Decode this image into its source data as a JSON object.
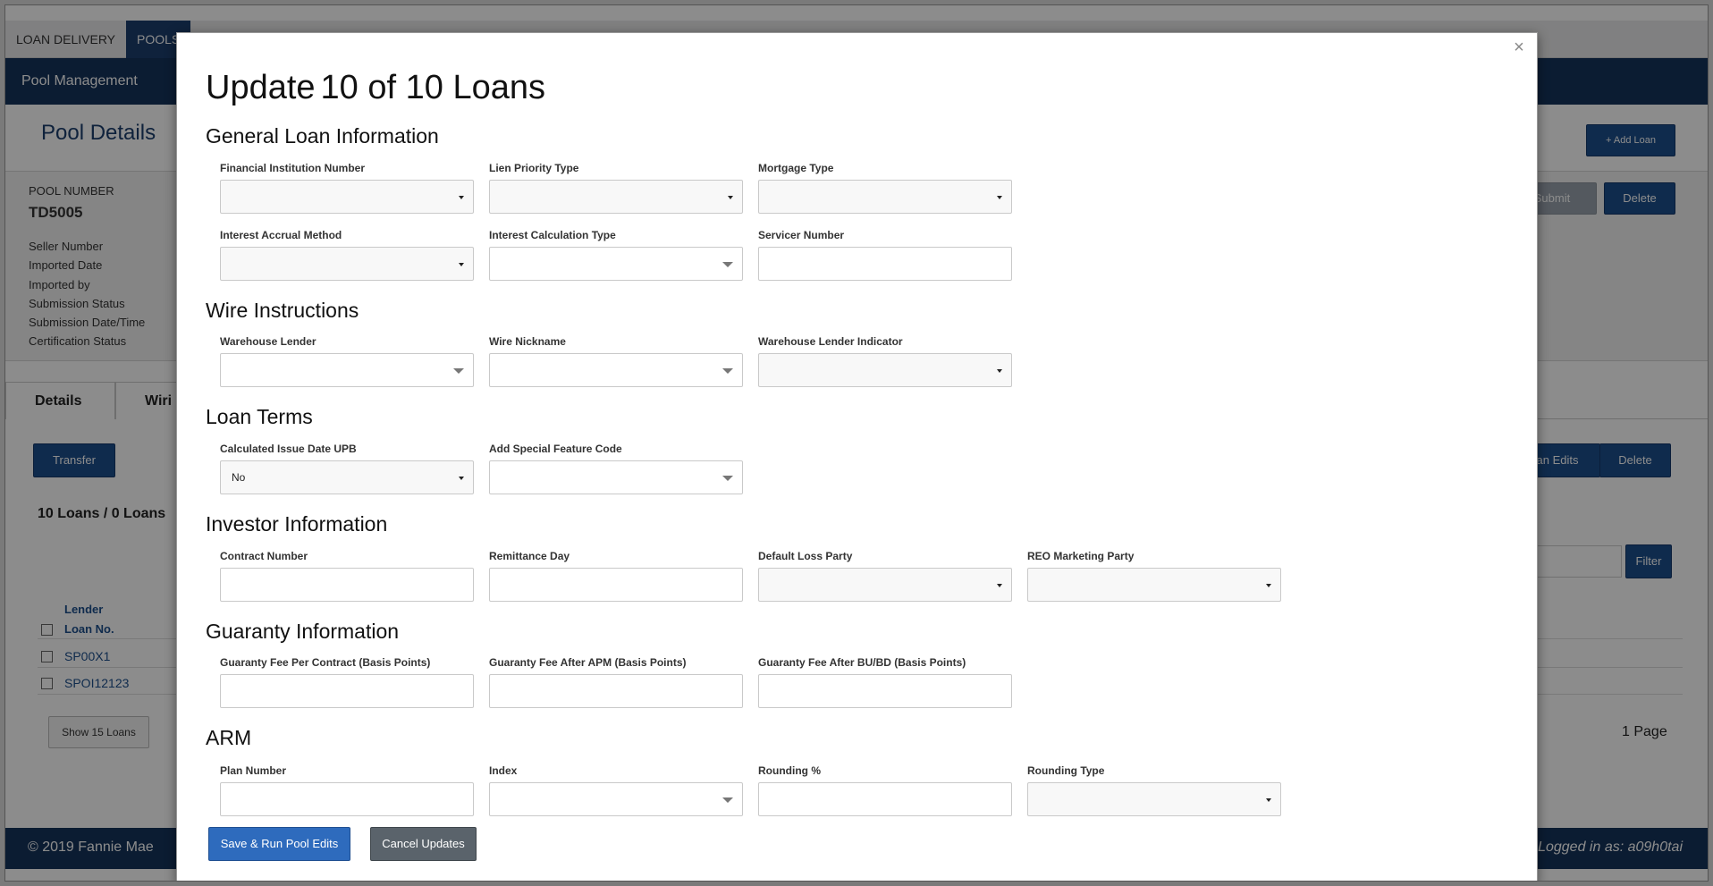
{
  "topnav": {
    "tabs": [
      "LOAN DELIVERY",
      "POOLS"
    ]
  },
  "subnav": {
    "title": "Pool Management"
  },
  "pool": {
    "header": "Pool Details",
    "add_loan": "+ Add Loan",
    "submit": "Submit",
    "delete": "Delete",
    "number_label": "POOL NUMBER",
    "number": "TD5005",
    "info_labels": [
      "Seller Number",
      "Imported Date",
      "Imported by",
      "Submission Status",
      "Submission Date/Time",
      "Certification Status"
    ]
  },
  "tabs": [
    "Details",
    "Wiri"
  ],
  "actions": {
    "transfer": "Transfer",
    "loan_edits": "an Edits",
    "delete": "Delete",
    "filter": "Filter"
  },
  "loans": {
    "count_num": "10",
    "count_text": "Loans / 0 Loans",
    "col_lender": "Lender",
    "col_loan_no": "Loan No.",
    "rows": [
      "SP00X1",
      "SPOI12123"
    ],
    "show": "Show 15 Loans",
    "pages": "1 Page"
  },
  "footer": {
    "copyright": "© 2019 Fannie Mae",
    "logged_in": "Logged in as: a09h0tai"
  },
  "modal": {
    "close": "×",
    "title_word": "Update",
    "title_count": "10 of 10 Loans",
    "sections": {
      "general": "General Loan Information",
      "wire": "Wire Instructions",
      "terms": "Loan Terms",
      "investor": "Investor Information",
      "guaranty": "Guaranty Information",
      "arm": "ARM"
    },
    "fields": {
      "fin_inst": "Financial Institution Number",
      "lien": "Lien Priority Type",
      "mortgage": "Mortgage Type",
      "accrual": "Interest Accrual Method",
      "calc_type": "Interest Calculation Type",
      "servicer": "Servicer Number",
      "wh_lender": "Warehouse Lender",
      "wire_nick": "Wire Nickname",
      "wh_indicator": "Warehouse Lender Indicator",
      "calc_upb": "Calculated Issue Date UPB",
      "calc_upb_value": "No",
      "special_code": "Add Special Feature Code",
      "contract": "Contract Number",
      "remit_day": "Remittance Day",
      "default_loss": "Default Loss Party",
      "reo": "REO Marketing Party",
      "gf_contract": "Guaranty Fee Per Contract (Basis Points)",
      "gf_apm": "Guaranty Fee After APM (Basis Points)",
      "gf_bubd": "Guaranty Fee After BU/BD (Basis Points)",
      "plan": "Plan Number",
      "index": "Index",
      "rounding_pct": "Rounding %",
      "rounding_type": "Rounding Type"
    },
    "save": "Save & Run Pool Edits",
    "cancel": "Cancel Updates"
  }
}
